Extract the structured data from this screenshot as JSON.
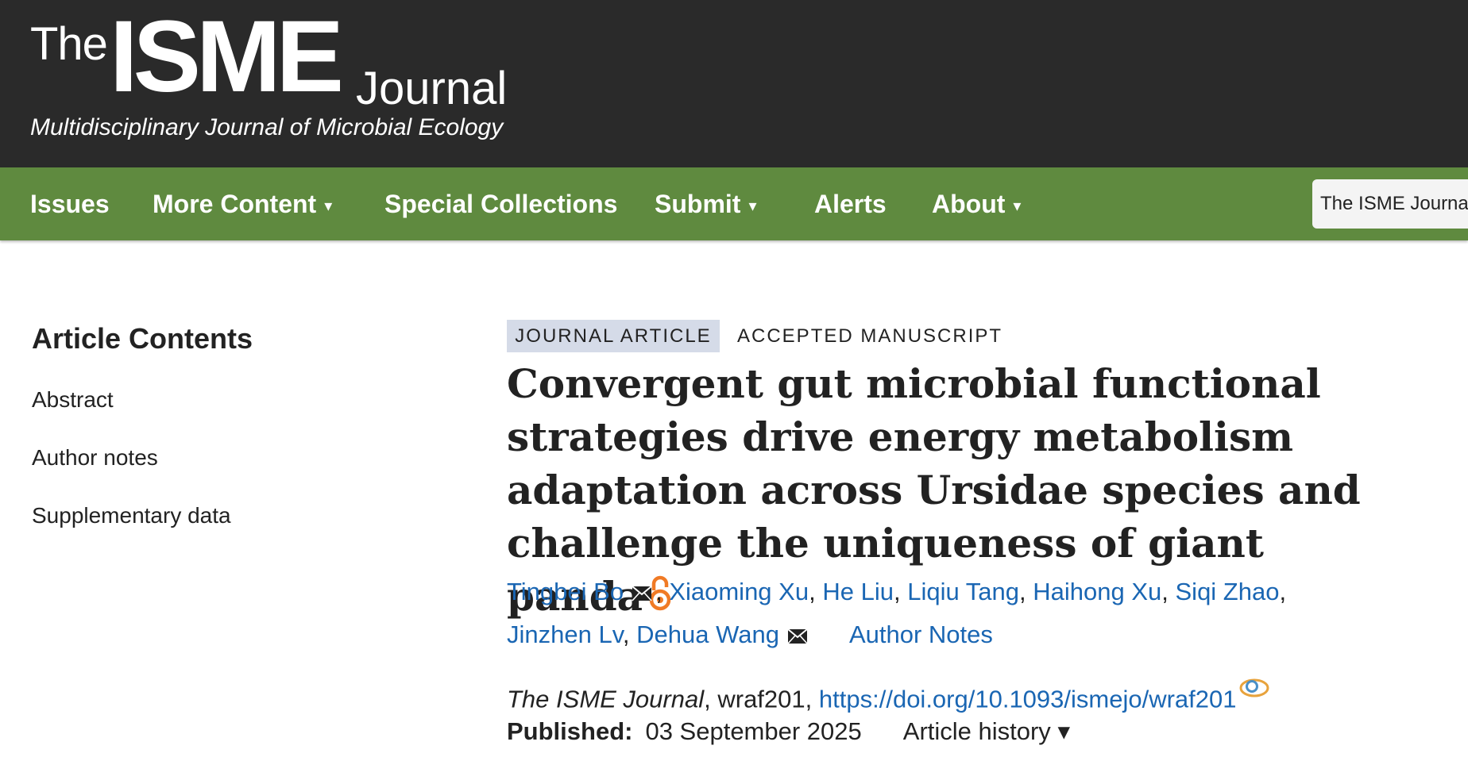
{
  "logo": {
    "the": "The",
    "isme": "ISME",
    "journal": "Journal",
    "tagline": "Multidisciplinary Journal of Microbial Ecology"
  },
  "nav": {
    "items": [
      {
        "label": "Issues",
        "dropdown": false
      },
      {
        "label": "More Content",
        "dropdown": true
      },
      {
        "label": "Special Collections",
        "dropdown": false
      },
      {
        "label": "Submit",
        "dropdown": true
      },
      {
        "label": "Alerts",
        "dropdown": false
      },
      {
        "label": "About",
        "dropdown": true
      }
    ],
    "caret": "▾",
    "journal_select": "The ISME Journal"
  },
  "sidebar": {
    "heading": "Article Contents",
    "links": [
      "Abstract",
      "Author notes",
      "Supplementary data"
    ]
  },
  "article": {
    "type_tag": "JOURNAL ARTICLE",
    "status_tag": "ACCEPTED MANUSCRIPT",
    "title": "Convergent gut microbial functional strategies drive energy metabolism adaptation across Ursidae species and challenge the uniqueness of giant panda",
    "open_access_icon": "open-access-icon",
    "authors": [
      "Tingbei Bo",
      "Xiaoming Xu",
      "He Liu",
      "Liqiu Tang",
      "Haihong Xu",
      "Siqi Zhao",
      "Jinzhen Lv",
      "Dehua Wang"
    ],
    "separator": ",",
    "author_notes_label": "Author Notes",
    "journal_name": "The ISME Journal",
    "article_id": "wraf201",
    "doi": "https://doi.org/10.1093/ismejo/wraf201",
    "published_label": "Published:",
    "published_date": "03 September 2025",
    "history_label": "Article history",
    "history_caret": "▾"
  },
  "colors": {
    "masthead": "#2a2a2a",
    "navbar": "#5f8a3f",
    "link": "#1a66b3",
    "tag_bg": "#d5dbe8",
    "open_access": "#f07a25"
  }
}
